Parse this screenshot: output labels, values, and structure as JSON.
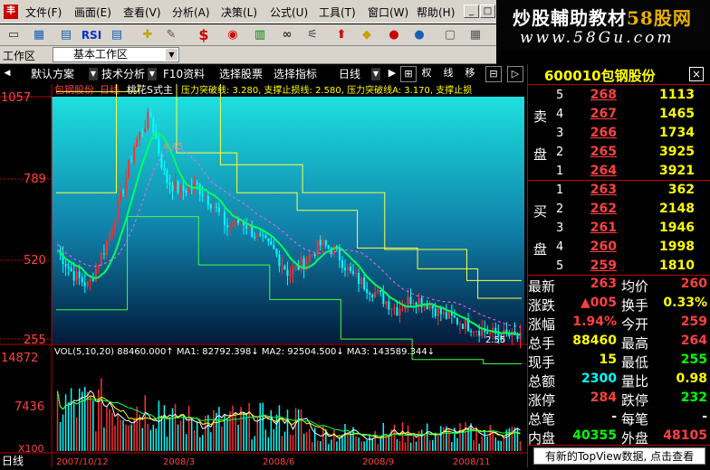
{
  "menu": {
    "items": [
      "文件(F)",
      "画面(E)",
      "查看(V)",
      "分析(A)",
      "决策(L)",
      "公式(U)",
      "工具(T)",
      "窗口(W)",
      "帮助(H)"
    ],
    "window_controls": [
      "_",
      "□",
      "x"
    ]
  },
  "watermark": {
    "line1_a": "炒股輔助教材",
    "line1_b": "58股网",
    "line2": "www.58Gu.com"
  },
  "toolbar": {
    "rsi_label": "RSI",
    "dollar_label": "$"
  },
  "workspace": {
    "label": "工作区",
    "selected": "基本工作区"
  },
  "nav": {
    "tabs": [
      "默认方案",
      "技术分析",
      "F10资料",
      "选择股票",
      "选择指标"
    ],
    "period": "日线",
    "buttons": [
      "▶",
      "⊞",
      "权",
      "线",
      "移",
      "⊟",
      "▷"
    ]
  },
  "chart": {
    "header_name": "包钢股份",
    "header_period": "日线",
    "header_indicator": "桃花S式主",
    "header_values": "压力突破线: 3.280, 支撑止损线: 2.580, 压力突破线A: 3.170, 支撑止损",
    "price_axis": [
      "1057",
      "789",
      "520",
      "255"
    ],
    "peak_label": "4.45",
    "low_label": "2.55",
    "vol_header": "VOL(5,10,20)  88460.000↑  MA1: 82792.398↓  MA2: 92504.500↓  MA3: 143589.344↓",
    "vol_axis": [
      "14872",
      "7436",
      "X100"
    ],
    "bottom_label": "日线",
    "date_axis": [
      "2007/10/12",
      "2008/3",
      "2008/6",
      "2008/9",
      "2008/11"
    ]
  },
  "chart_data": {
    "type": "line",
    "title": "包钢股份 日线",
    "ylim": [
      255,
      1057
    ],
    "series": [
      {
        "name": "close",
        "values": [
          3.3,
          3.1,
          3.0,
          3.3,
          3.7,
          4.2,
          4.45,
          3.9,
          3.8,
          3.85,
          3.7,
          3.5,
          3.55,
          3.4,
          3.3,
          3.1,
          3.2,
          3.35,
          3.3,
          3.1,
          3.0,
          2.9,
          2.8,
          2.9,
          2.85,
          2.75,
          2.7,
          2.65,
          2.6,
          2.58,
          2.55
        ]
      }
    ],
    "volume_ylim": [
      0,
      14872
    ],
    "vol_ma": {
      "MA1": 82792.398,
      "MA2": 92504.5,
      "MA3": 143589.344
    }
  },
  "quote": {
    "code": "600010",
    "name": "包钢股份",
    "sell_side_label": [
      "卖",
      "盘"
    ],
    "buy_side_label": [
      "买",
      "盘"
    ],
    "sell": [
      {
        "level": "5",
        "price": "268",
        "vol": "1113"
      },
      {
        "level": "4",
        "price": "267",
        "vol": "1465"
      },
      {
        "level": "3",
        "price": "266",
        "vol": "1734"
      },
      {
        "level": "2",
        "price": "265",
        "vol": "3925"
      },
      {
        "level": "1",
        "price": "264",
        "vol": "3921"
      }
    ],
    "buy": [
      {
        "level": "1",
        "price": "263",
        "vol": "362"
      },
      {
        "level": "2",
        "price": "262",
        "vol": "2148"
      },
      {
        "level": "3",
        "price": "261",
        "vol": "1946"
      },
      {
        "level": "4",
        "price": "260",
        "vol": "1998"
      },
      {
        "level": "5",
        "price": "259",
        "vol": "1810"
      }
    ],
    "stats": [
      {
        "k1": "最新",
        "v1": "263",
        "c1": "#ff4040",
        "k2": "均价",
        "v2": "260",
        "c2": "#ff4040"
      },
      {
        "k1": "涨跌",
        "v1": "▲005",
        "c1": "#ff4040",
        "k2": "换手",
        "v2": "0.33%",
        "c2": "#ffff00"
      },
      {
        "k1": "涨幅",
        "v1": "1.94%",
        "c1": "#ff4040",
        "k2": "今开",
        "v2": "259",
        "c2": "#ff4040"
      },
      {
        "k1": "总手",
        "v1": "88460",
        "c1": "#ffff00",
        "k2": "最高",
        "v2": "264",
        "c2": "#ff4040"
      },
      {
        "k1": "现手",
        "v1": "15",
        "c1": "#ffff00",
        "k2": "最低",
        "v2": "255",
        "c2": "#00ff00"
      },
      {
        "k1": "总额",
        "v1": "2300",
        "c1": "#00ffff",
        "k2": "量比",
        "v2": "0.98",
        "c2": "#ffff00"
      },
      {
        "k1": "涨停",
        "v1": "284",
        "c1": "#ff4040",
        "k2": "跌停",
        "v2": "232",
        "c2": "#00ff00"
      },
      {
        "k1": "总笔",
        "v1": "-",
        "c1": "#ffffff",
        "k2": "每笔",
        "v2": "-",
        "c2": "#ffffff"
      },
      {
        "k1": "内盘",
        "v1": "40355",
        "c1": "#00ff00",
        "k2": "外盘",
        "v2": "48105",
        "c2": "#ff4040"
      }
    ],
    "topview_button": "有新的TopView数据, 点击查看"
  }
}
